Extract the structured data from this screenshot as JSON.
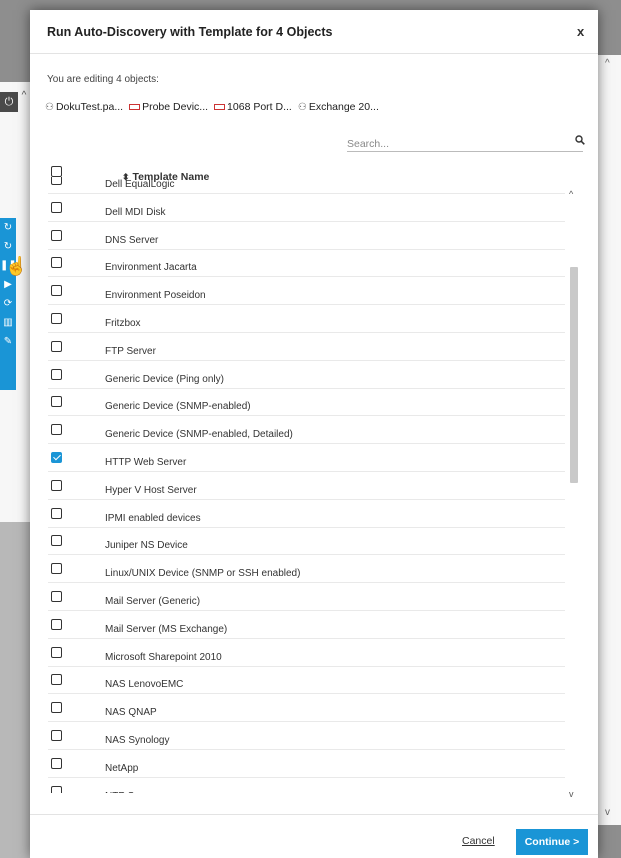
{
  "dialog": {
    "title": "Run Auto-Discovery with Template for 4 Objects",
    "close_label": "x",
    "editing_label": "You are editing 4 objects:",
    "objects": [
      {
        "icon": "group-icon",
        "label": "DokuTest.pa..."
      },
      {
        "icon": "device-icon",
        "label": "Probe Devic..."
      },
      {
        "icon": "device-icon",
        "label": "1068 Port D..."
      },
      {
        "icon": "group-icon",
        "label": "Exchange 20..."
      }
    ],
    "search_placeholder": "Search...",
    "column_header": "Template Name",
    "templates": [
      {
        "name": "Dell EqualLogic",
        "checked": false
      },
      {
        "name": "Dell MDI Disk",
        "checked": false
      },
      {
        "name": "DNS Server",
        "checked": false
      },
      {
        "name": "Environment Jacarta",
        "checked": false
      },
      {
        "name": "Environment Poseidon",
        "checked": false
      },
      {
        "name": "Fritzbox",
        "checked": false
      },
      {
        "name": "FTP Server",
        "checked": false
      },
      {
        "name": "Generic Device (Ping only)",
        "checked": false
      },
      {
        "name": "Generic Device (SNMP-enabled)",
        "checked": false
      },
      {
        "name": "Generic Device (SNMP-enabled, Detailed)",
        "checked": false
      },
      {
        "name": "HTTP Web Server",
        "checked": true
      },
      {
        "name": "Hyper V Host Server",
        "checked": false
      },
      {
        "name": "IPMI enabled devices",
        "checked": false
      },
      {
        "name": "Juniper NS Device",
        "checked": false
      },
      {
        "name": "Linux/UNIX Device (SNMP or SSH enabled)",
        "checked": false
      },
      {
        "name": "Mail Server (Generic)",
        "checked": false
      },
      {
        "name": "Mail Server (MS Exchange)",
        "checked": false
      },
      {
        "name": "Microsoft Sharepoint 2010",
        "checked": false
      },
      {
        "name": "NAS LenovoEMC",
        "checked": false
      },
      {
        "name": "NAS QNAP",
        "checked": false
      },
      {
        "name": "NAS Synology",
        "checked": false
      },
      {
        "name": "NetApp",
        "checked": false
      },
      {
        "name": "NTP Server",
        "checked": false
      }
    ],
    "cancel_label": "Cancel",
    "continue_label": "Continue >"
  },
  "colors": {
    "accent": "#1a95d6"
  }
}
